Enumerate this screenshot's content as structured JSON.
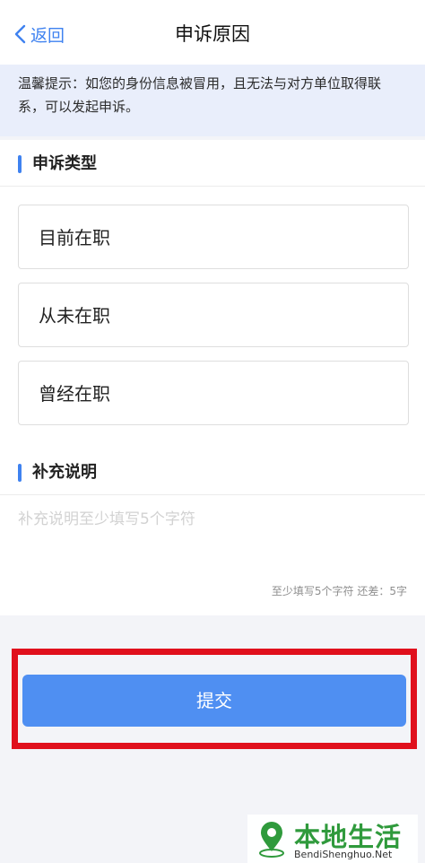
{
  "nav": {
    "back_label": "返回",
    "title": "申诉原因"
  },
  "tip": {
    "text": "温馨提示：如您的身份信息被冒用，且无法与对方单位取得联系，可以发起申诉。"
  },
  "complaint_type": {
    "heading": "申诉类型",
    "options": [
      "目前在职",
      "从未在职",
      "曾经在职"
    ]
  },
  "supplement": {
    "heading": "补充说明",
    "placeholder": "补充说明至少填写5个字符",
    "value": "",
    "counter": "至少填写5个字符 还差：5字"
  },
  "submit_label": "提交",
  "watermark": {
    "title": "本地生活",
    "site": "BendiShenghuo.Net"
  },
  "colors": {
    "accent": "#3f82f0",
    "button": "#4f8ff2",
    "tip_bg": "#e9eefb",
    "highlight": "#e0101d",
    "watermark_green": "#2f9a3c"
  },
  "icons": {
    "back": "chevron-left-icon",
    "watermark": "map-pin-icon"
  }
}
